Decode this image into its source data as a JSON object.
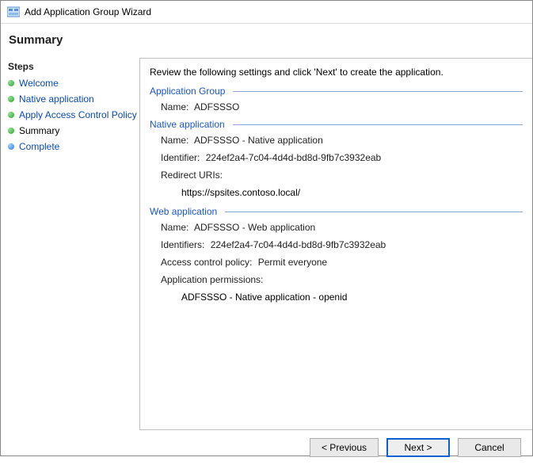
{
  "window": {
    "title": "Add Application Group Wizard"
  },
  "header": {
    "title": "Summary"
  },
  "steps": {
    "heading": "Steps",
    "items": [
      {
        "label": "Welcome",
        "status": "done"
      },
      {
        "label": "Native application",
        "status": "done"
      },
      {
        "label": "Apply Access Control Policy",
        "status": "done"
      },
      {
        "label": "Summary",
        "status": "done",
        "current": true
      },
      {
        "label": "Complete",
        "status": "pending"
      }
    ]
  },
  "panel": {
    "intro": "Review the following settings and click 'Next' to create the application.",
    "groups": {
      "app_group": {
        "title": "Application Group",
        "name_label": "Name:",
        "name_value": "ADFSSSO"
      },
      "native_app": {
        "title": "Native application",
        "name_label": "Name:",
        "name_value": "ADFSSSO - Native application",
        "identifier_label": "Identifier:",
        "identifier_value": "224ef2a4-7c04-4d4d-bd8d-9fb7c3932eab",
        "redirect_label": "Redirect URIs:",
        "redirect_value": "https://spsites.contoso.local/"
      },
      "web_app": {
        "title": "Web application",
        "name_label": "Name:",
        "name_value": "ADFSSSO - Web application",
        "identifiers_label": "Identifiers:",
        "identifiers_value": "224ef2a4-7c04-4d4d-bd8d-9fb7c3932eab",
        "acp_label": "Access control policy:",
        "acp_value": "Permit everyone",
        "perm_label": "Application permissions:",
        "perm_value": "ADFSSSO - Native application - openid"
      }
    }
  },
  "footer": {
    "previous": "< Previous",
    "next": "Next >",
    "cancel": "Cancel"
  }
}
